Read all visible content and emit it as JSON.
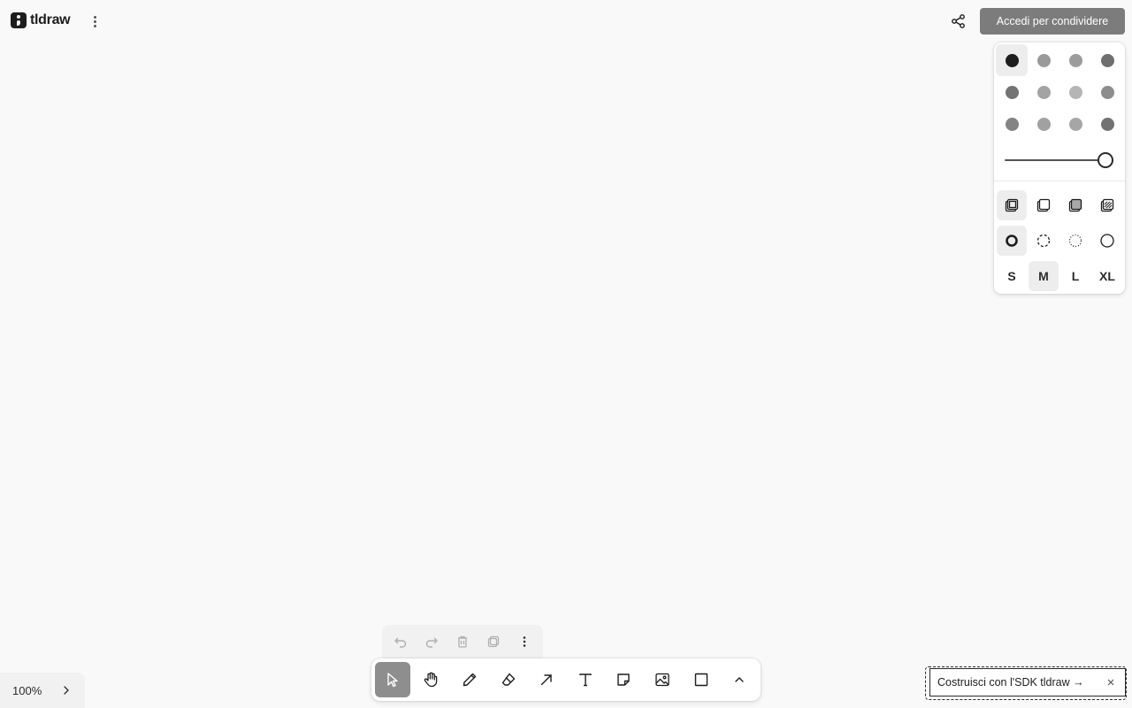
{
  "brand": {
    "name": "tldraw"
  },
  "header": {
    "share_button_label": "Accedi per condividere"
  },
  "style_panel": {
    "colors": [
      {
        "name": "black",
        "hex": "#1d1d1d",
        "selected": true
      },
      {
        "name": "grey",
        "hex": "#9a9a9a"
      },
      {
        "name": "light-violet",
        "hex": "#9c9c9c"
      },
      {
        "name": "violet",
        "hex": "#6f6f6f"
      },
      {
        "name": "blue",
        "hex": "#737373"
      },
      {
        "name": "light-blue",
        "hex": "#a3a3a3"
      },
      {
        "name": "yellow",
        "hex": "#b5b5b5"
      },
      {
        "name": "orange",
        "hex": "#8d8d8d"
      },
      {
        "name": "green",
        "hex": "#848484"
      },
      {
        "name": "light-green",
        "hex": "#a1a1a1"
      },
      {
        "name": "light-red",
        "hex": "#a6a6a6"
      },
      {
        "name": "red",
        "hex": "#727272"
      }
    ],
    "opacity": 1,
    "sizes": [
      "S",
      "M",
      "L",
      "XL"
    ],
    "selected_size": "M"
  },
  "zoom": {
    "label": "100%"
  },
  "sdk_banner": {
    "label": "Costruisci con l'SDK tldraw →"
  }
}
